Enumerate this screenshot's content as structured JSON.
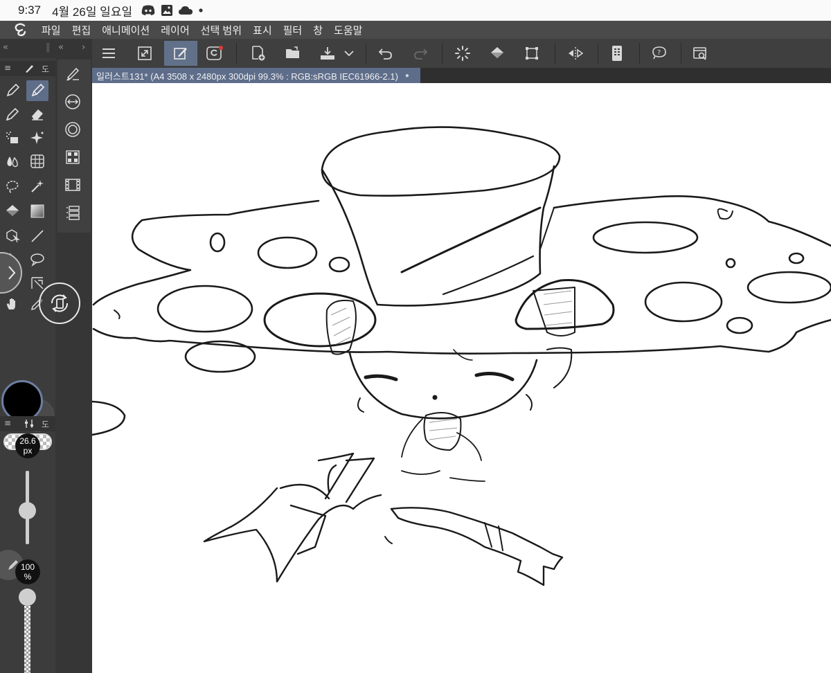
{
  "status_bar": {
    "time": "9:37",
    "date": "4월 26일 일요일",
    "icons": [
      "discord-icon",
      "gallery-icon",
      "cloud-icon",
      "dot-icon"
    ]
  },
  "menu": {
    "logo": "clip-studio-logo",
    "items": [
      "파일",
      "편집",
      "애니메이션",
      "레이어",
      "선택 범위",
      "표시",
      "필터",
      "창",
      "도움말"
    ]
  },
  "toolbar": {
    "buttons": [
      "menu-icon",
      "fullscreen-icon",
      "brush-settings-icon",
      "clip-studio-services-icon",
      "new-file-icon",
      "open-folder-icon",
      "save-icon",
      "dropdown-icon",
      "undo-icon",
      "redo-icon",
      "loading-icon",
      "fill-icon",
      "transform-icon",
      "flip-icon",
      "smartphone-icon",
      "help-icon",
      "assets-icon"
    ],
    "active": "brush-settings-icon"
  },
  "document": {
    "tab_title": "일러스트131* (A4 3508 x 2480px 300dpi 99.3% : RGB:sRGB IEC61966-2.1)",
    "tab_dot": "●"
  },
  "tool_panel": {
    "header_label": "도",
    "sub_header_label": "도",
    "tools": [
      "pen-icon",
      "pencil-icon",
      "marker-icon",
      "eraser-icon",
      "airbrush-icon",
      "sparkle-icon",
      "blend-icon",
      "grid-icon",
      "lasso-icon",
      "magic-wand-icon",
      "bucket-icon",
      "gradient-icon",
      "object-select-icon",
      "line-icon",
      "operation-icon",
      "speech-bubble-icon",
      "hand-icon",
      "eyedropper-icon"
    ],
    "active_tool": "pencil-icon"
  },
  "colors": {
    "main": "#000000",
    "sub": "#4a4a4a",
    "accent": "#62718a"
  },
  "brush": {
    "size_value": "26.6",
    "size_unit": "px",
    "size_level": 0.45,
    "opacity_value": "100",
    "opacity_unit": "%",
    "opacity_level": 1.0
  }
}
